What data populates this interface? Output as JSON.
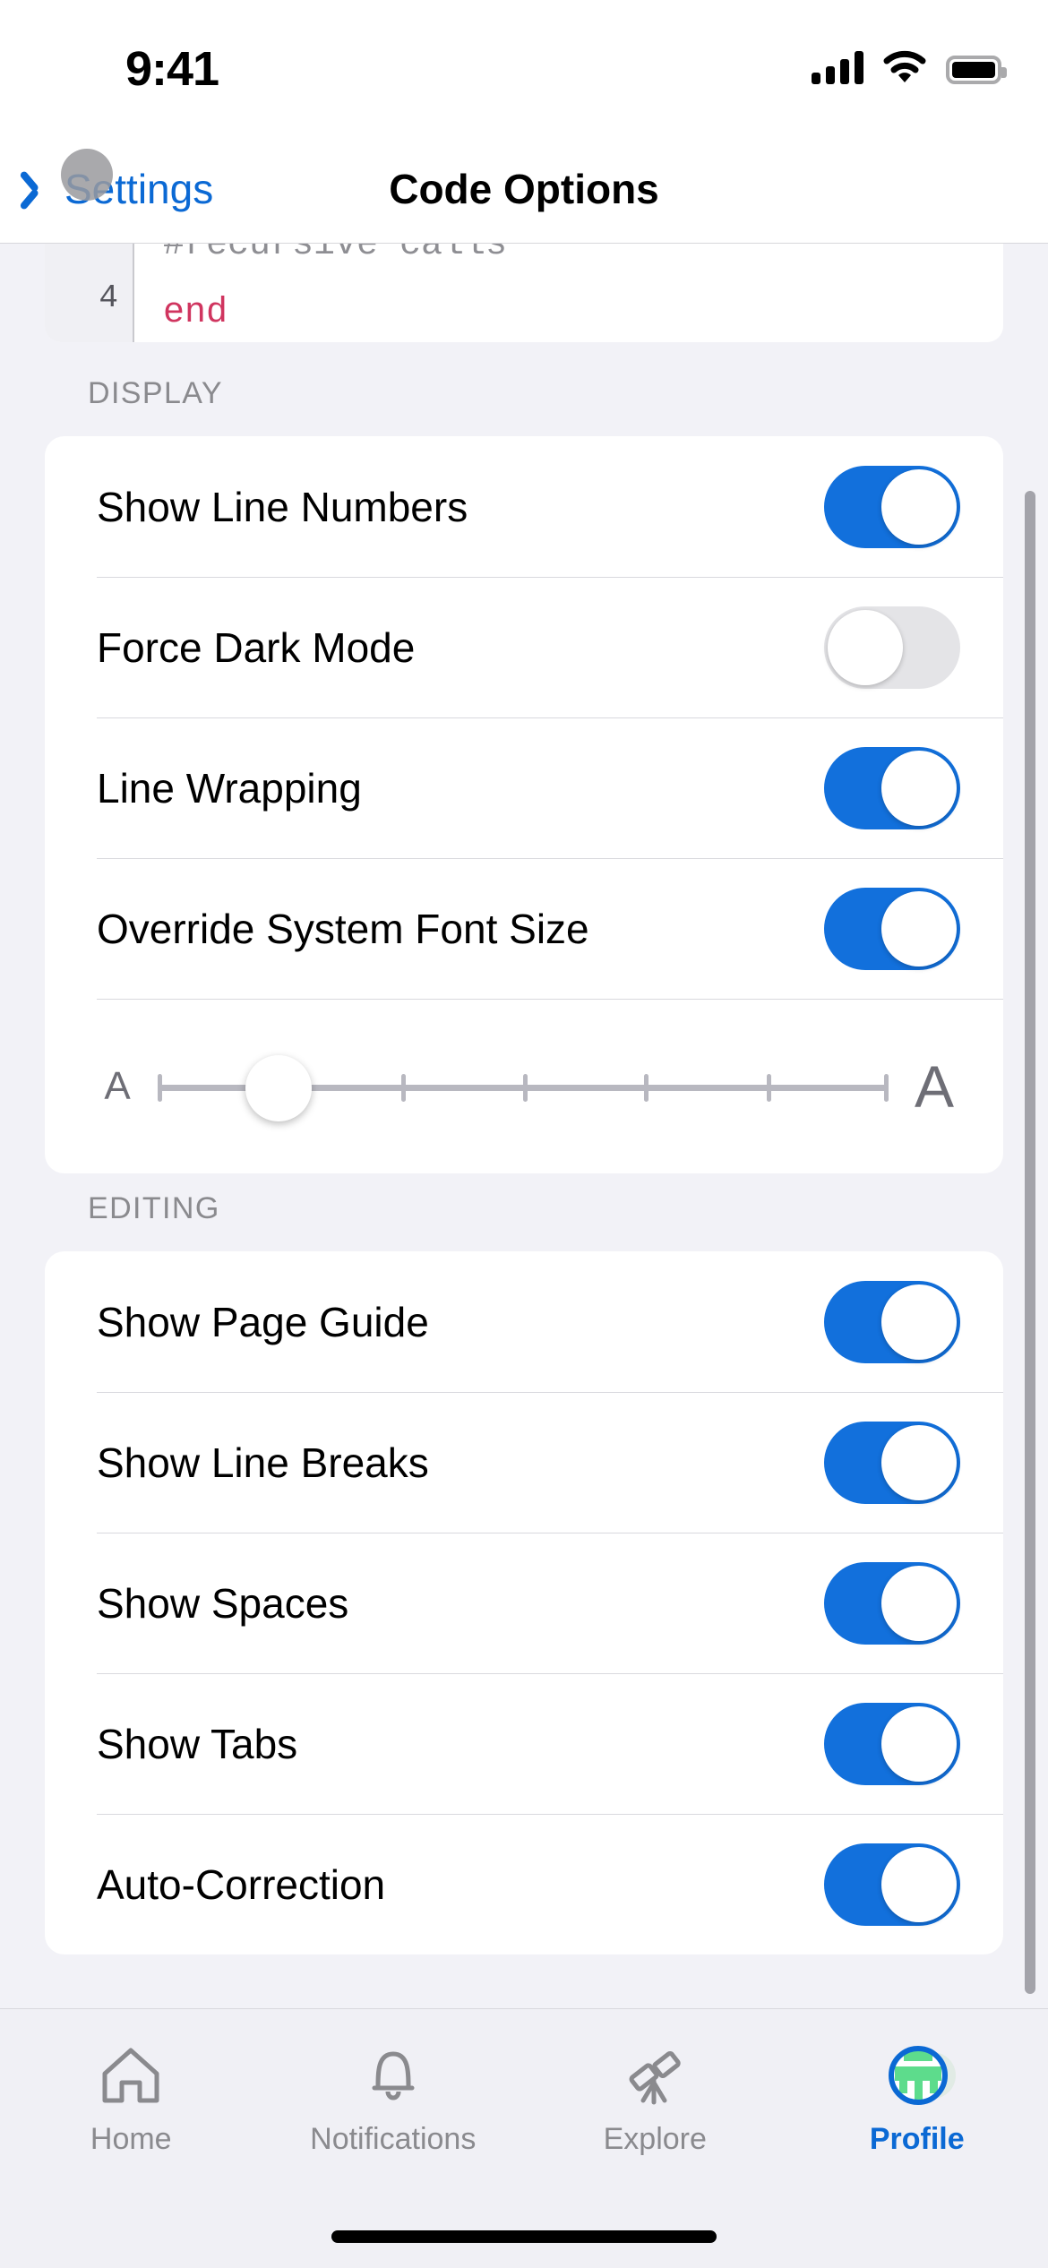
{
  "status_bar": {
    "time": "9:41",
    "signal_icon": "cellular-signal-icon",
    "wifi_icon": "wifi-icon",
    "battery_icon": "battery-full-icon"
  },
  "nav": {
    "back_label": "Settings",
    "back_icon": "chevron-left-icon",
    "title": "Code Options",
    "accent_color": "#0B69D4"
  },
  "code_preview": {
    "line_number": "4",
    "comment_line": "#recursive calls",
    "code_line": "end",
    "comment_color": "#8E8E93",
    "keyword_color": "#D0355F"
  },
  "sections": [
    {
      "header": "DISPLAY",
      "rows": [
        {
          "label": "Show Line Numbers",
          "value": "on"
        },
        {
          "label": "Force Dark Mode",
          "value": "off"
        },
        {
          "label": "Line Wrapping",
          "value": "on"
        },
        {
          "label": "Override System Font Size",
          "value": "on"
        }
      ],
      "slider": {
        "min_label": "A",
        "max_label": "A",
        "ticks": 7,
        "position": 1,
        "name": "font-size-slider"
      }
    },
    {
      "header": "EDITING",
      "rows": [
        {
          "label": "Show Page Guide",
          "value": "on"
        },
        {
          "label": "Show Line Breaks",
          "value": "on"
        },
        {
          "label": "Show Spaces",
          "value": "on"
        },
        {
          "label": "Show Tabs",
          "value": "on"
        },
        {
          "label": "Auto-Correction",
          "value": "on"
        }
      ]
    }
  ],
  "toggle_colors": {
    "on": "#1270DC",
    "off": "#E4E4E7"
  },
  "tab_bar": {
    "items": [
      {
        "label": "Home",
        "icon": "home-icon",
        "active": false
      },
      {
        "label": "Notifications",
        "icon": "bell-icon",
        "active": false
      },
      {
        "label": "Explore",
        "icon": "telescope-icon",
        "active": false
      },
      {
        "label": "Profile",
        "icon": "avatar-icon",
        "active": true
      }
    ],
    "active_color": "#0B69D4",
    "inactive_color": "#8A8A8E"
  }
}
